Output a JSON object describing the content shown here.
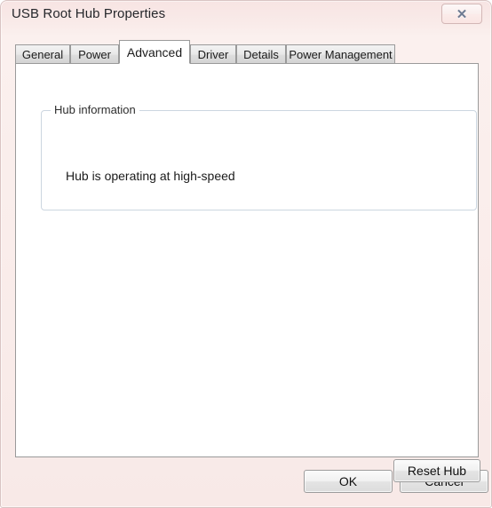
{
  "window": {
    "title": "USB Root Hub Properties",
    "close_button_label": "Close",
    "close_icon_glyph": "✕"
  },
  "tabs": [
    {
      "label": "General",
      "active": false
    },
    {
      "label": "Power",
      "active": false
    },
    {
      "label": "Advanced",
      "active": true
    },
    {
      "label": "Driver",
      "active": false
    },
    {
      "label": "Details",
      "active": false
    },
    {
      "label": "Power Management",
      "active": false
    }
  ],
  "advanced_tab": {
    "group": {
      "label": "Hub information",
      "status_text": "Hub is operating at high-speed"
    },
    "reset_hub_label": "Reset Hub"
  },
  "footer": {
    "ok_label": "OK",
    "cancel_label": "Cancel"
  },
  "colors": {
    "frame": "#f8e9e7",
    "title_text": "#25272b",
    "panel": "#ffffff",
    "groupbox_border": "#ccd6e0",
    "tab_border": "#9a9a9a",
    "button_face": "#f1f1f1"
  }
}
